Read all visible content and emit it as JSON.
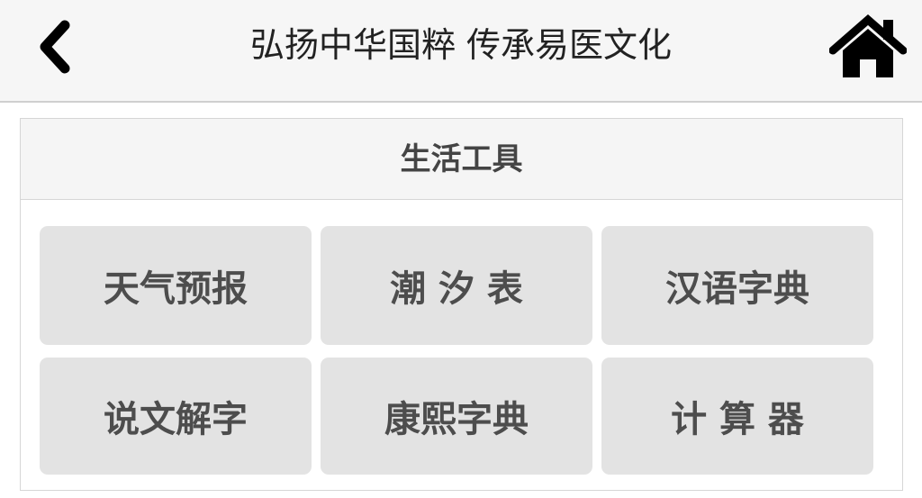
{
  "header": {
    "title": "弘扬中华国粹 传承易医文化",
    "back_icon": "chevron-left-icon",
    "home_icon": "home-icon"
  },
  "panel": {
    "title": "生活工具",
    "tools": [
      {
        "label": "天气预报"
      },
      {
        "label": "潮 汐 表"
      },
      {
        "label": "汉语字典"
      },
      {
        "label": "说文解字"
      },
      {
        "label": "康熙字典"
      },
      {
        "label": "计 算 器"
      }
    ]
  },
  "colors": {
    "header_bg": "#f6f6f6",
    "button_bg": "#e3e3e3",
    "button_text": "#4d4d4d",
    "title_text": "#222222"
  }
}
